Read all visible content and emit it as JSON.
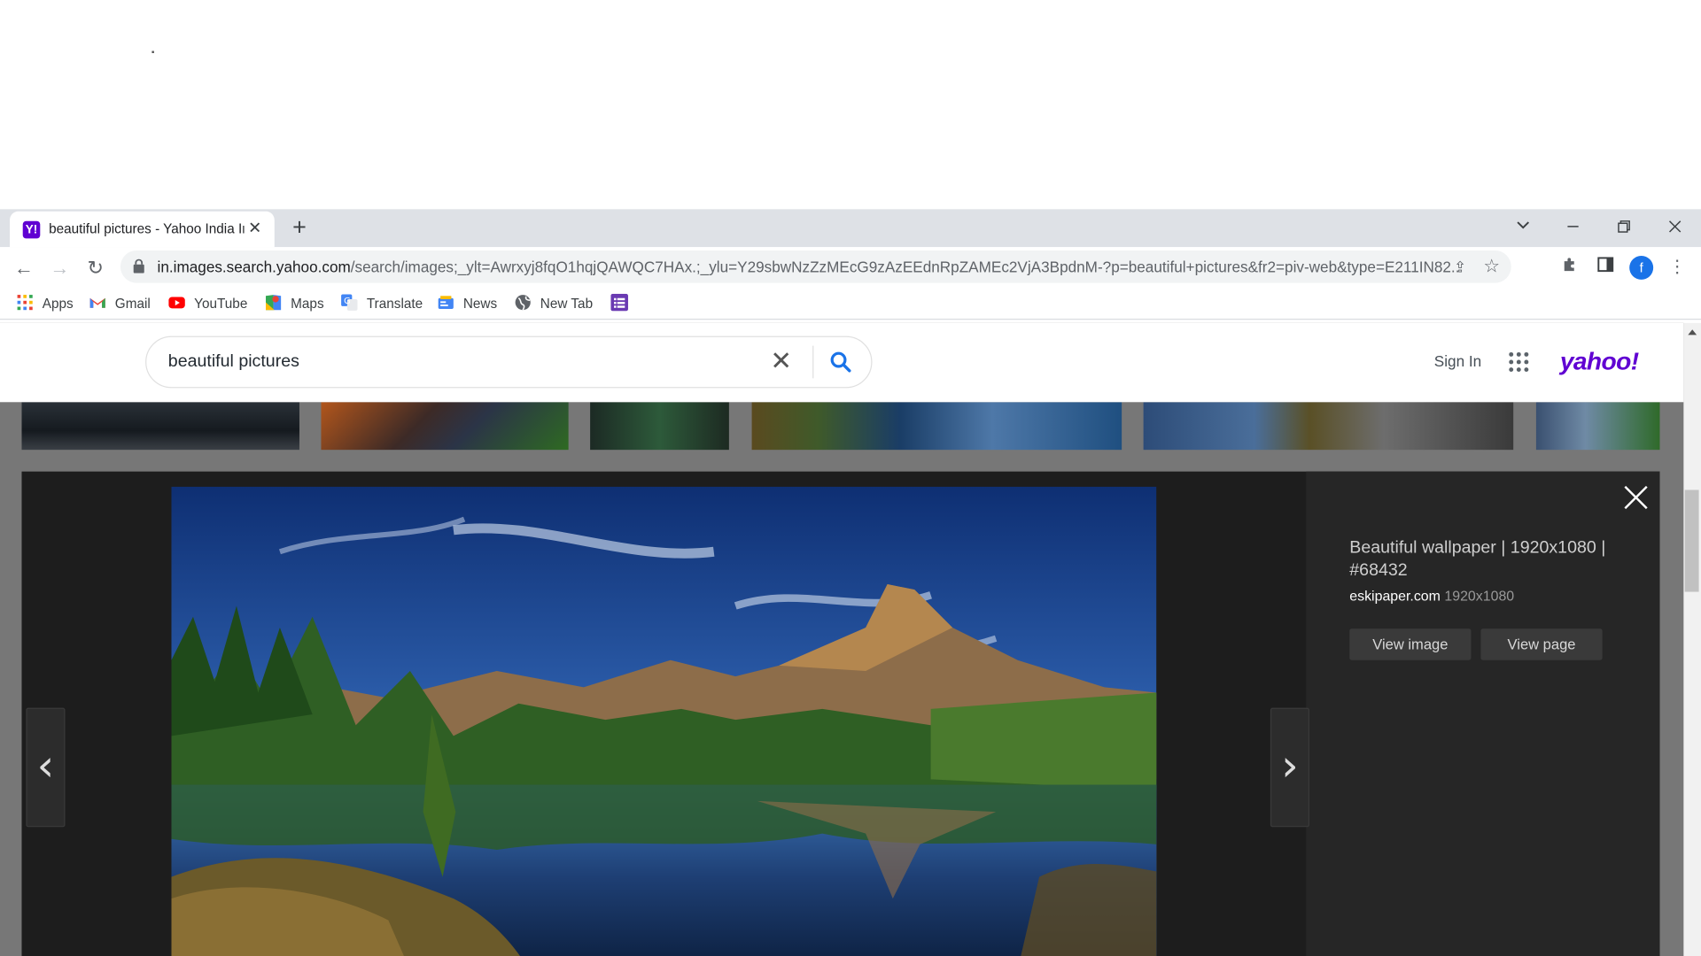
{
  "browser": {
    "tab_title": "beautiful pictures - Yahoo India Image Search Results",
    "tab_favicon": "Y!",
    "url_host": "in.images.search.yahoo.com",
    "url_path": "/search/images;_ylt=Awrxyj8fqO1hqjQAWQC7HAx.;_ylu=Y29sbwNzZzMEcG9zAzEEdnRpZAMEc2VjA3BpdnM-?p=beautiful+pictures&fr2=piv-web&type=E211IN82...",
    "profile_initial": "f",
    "bookmarks": [
      {
        "label": "Apps",
        "icon": "apps-grid-icon"
      },
      {
        "label": "Gmail",
        "icon": "gmail-icon"
      },
      {
        "label": "YouTube",
        "icon": "youtube-icon"
      },
      {
        "label": "Maps",
        "icon": "maps-icon"
      },
      {
        "label": "Translate",
        "icon": "translate-icon"
      },
      {
        "label": "News",
        "icon": "news-icon"
      },
      {
        "label": "New Tab",
        "icon": "globe-icon"
      },
      {
        "label": "",
        "icon": "list-icon"
      }
    ]
  },
  "search": {
    "query": "beautiful pictures",
    "sign_in": "Sign In",
    "logo": "yahoo!"
  },
  "viewer": {
    "title": "Beautiful wallpaper | 1920x1080 | #68432",
    "source_domain": "eskipaper.com",
    "dimensions": "1920x1080",
    "view_image": "View image",
    "view_page": "View page"
  },
  "colors": {
    "yahoo_purple": "#6001d2",
    "search_blue": "#1a73e8",
    "viewer_bg": "#1d1d1d"
  }
}
